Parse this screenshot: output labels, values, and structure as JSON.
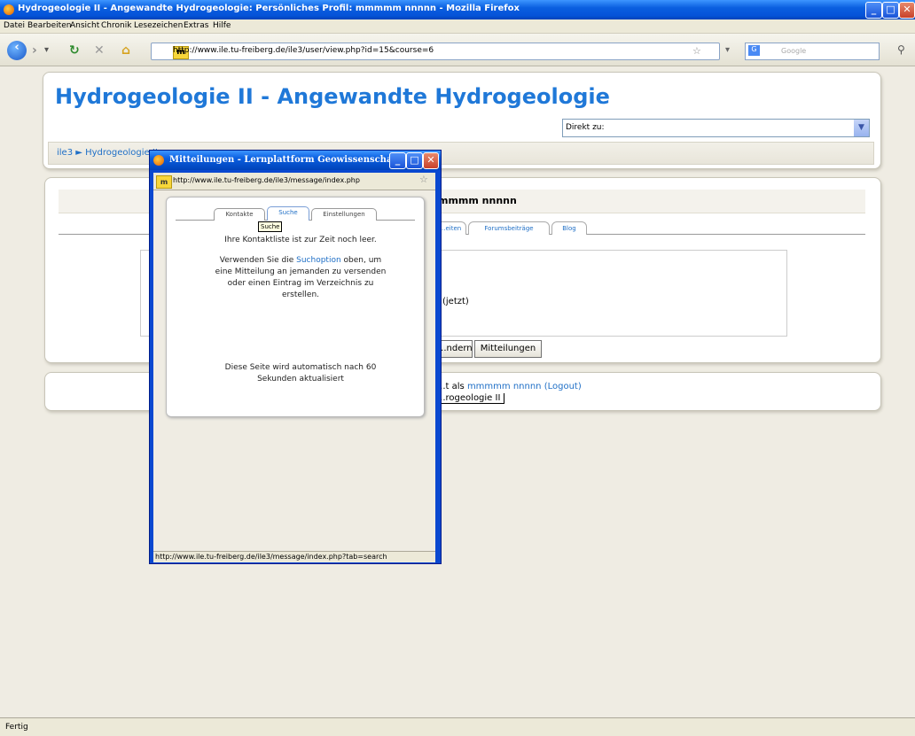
{
  "window": {
    "title": "Hydrogeologie II - Angewandte Hydrogeologie: Persönliches Profil: mmmmm nnnnn - Mozilla Firefox",
    "minimize": "_",
    "maximize": "□",
    "close": "✕"
  },
  "menu": [
    "Datei",
    "Bearbeiten",
    "Ansicht",
    "Chronik",
    "Lesezeichen",
    "Extras",
    "Hilfe"
  ],
  "nav": {
    "url": "http://www.ile.tu-freiberg.de/ile3/user/view.php?id=15&course=6",
    "search_placeholder": "Google"
  },
  "page": {
    "heading": "Hydrogeologie II - Angewandte Hydrogeologie",
    "jump_label": "Direkt zu:",
    "breadcrumb": "ile3 ► Hydrogeologie II",
    "profile_name": "mmmm nnnnn",
    "tabs": [
      "...eiten",
      "Forumsbeiträge",
      "Blog"
    ],
    "last_access": "(jetzt)",
    "buttons": [
      "...ndern",
      "Mitteilungen"
    ],
    "login_info_prefix": "...t als ",
    "login_user": "mmmmm nnnnn",
    "logout": "(Logout)",
    "course_link": "...rogeologie II"
  },
  "popup": {
    "title": "Mitteilungen - Lernplattform Geowissenschafte...",
    "url": "http://www.ile.tu-freiberg.de/ile3/message/index.php",
    "tabs": [
      "Kontakte",
      "Suche",
      "Einstellungen"
    ],
    "tooltip": "Suche",
    "line1": "Ihre Kontaktliste ist zur Zeit noch leer.",
    "para": [
      "Verwenden Sie die ",
      "Suchoption",
      " oben, um",
      "eine Mitteilung an jemanden zu versenden",
      "oder einen Eintrag im Verzeichnis zu",
      "erstellen."
    ],
    "refresh1": "Diese Seite wird automatisch nach 60",
    "refresh2": "Sekunden aktualisiert",
    "status": "http://www.ile.tu-freiberg.de/ile3/message/index.php?tab=search"
  },
  "status": "Fertig",
  "colors": {
    "accent": "#1f78d8",
    "link": "#1f6fc6",
    "titlebar": "#0a5fe0"
  }
}
